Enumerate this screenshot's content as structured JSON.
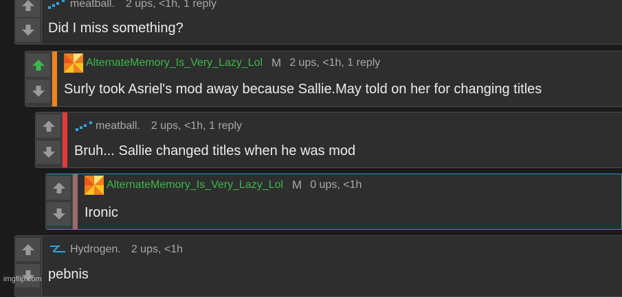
{
  "colors": {
    "background": "#1b1b1b",
    "card": "#2e2e2e",
    "stripe_orange": "#f0841e",
    "stripe_red": "#e33a3a",
    "stripe_gray": "#9a6a6a",
    "username_green": "#3cb84a",
    "upvoted_arrow": "#3cb84a"
  },
  "comments": [
    {
      "author": "meatball.",
      "avatar_icon": "pixel-dots-icon",
      "badge": "",
      "stats": "2 ups, <1h, 1 reply",
      "text": "Did I miss something?",
      "upvoted": false
    },
    {
      "author": "AlternateMemory_Is_Very_Lazy_Lol",
      "avatar_icon": "pinwheel-icon",
      "badge": "M",
      "stats": "2 ups, <1h, 1 reply",
      "text": "Surly took Asriel's mod away because Sallie.May told on her for changing titles",
      "upvoted": true
    },
    {
      "author": "meatball.",
      "avatar_icon": "pixel-dots-icon",
      "badge": "",
      "stats": "2 ups, <1h, 1 reply",
      "text": "Bruh... Sallie changed titles when he was mod",
      "upvoted": false
    },
    {
      "author": "AlternateMemory_Is_Very_Lazy_Lol",
      "avatar_icon": "pinwheel-icon",
      "badge": "M",
      "stats": "0 ups, <1h",
      "text": "Ironic",
      "upvoted": false
    },
    {
      "author": "Hydrogen.",
      "avatar_icon": "hydrogen-symbol-icon",
      "badge": "",
      "stats": "2 ups, <1h",
      "text": "pebnis",
      "upvoted": false
    }
  ],
  "watermark": "imgflip.com"
}
